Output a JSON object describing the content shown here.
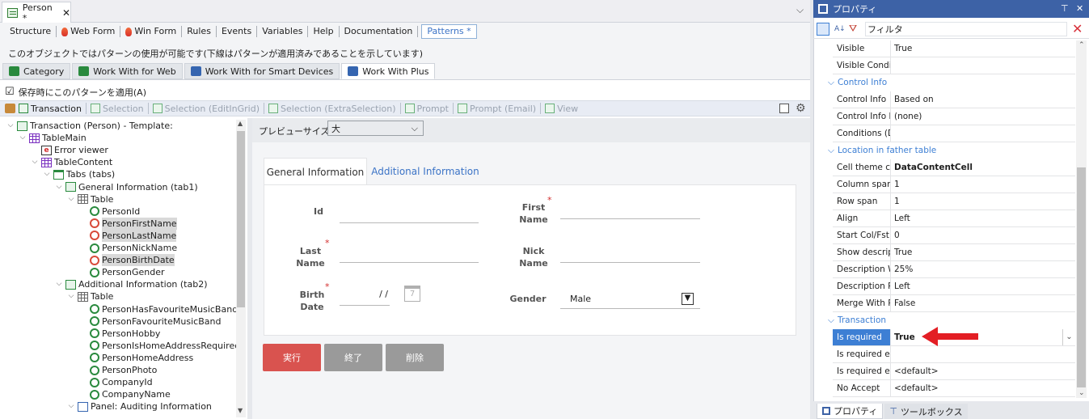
{
  "document_tab": {
    "title": "Person *",
    "close": "✕"
  },
  "collapse_glyph": "⌵",
  "view_tabs": [
    "Structure",
    "Web Form",
    "Win Form",
    "Rules",
    "Events",
    "Variables",
    "Help",
    "Documentation",
    "Patterns *"
  ],
  "message": "このオブジェクトではパターンの使用が可能です(下線はパターンが適用済みであることを示しています)",
  "pattern_tabs": [
    "Category",
    "Work With for Web",
    "Work With for Smart Devices",
    "Work With Plus"
  ],
  "apply_on_save": {
    "label": "保存時にこのパターンを適用(A)",
    "checked": "☑"
  },
  "template_tabs": [
    "Transaction",
    "Selection",
    "Selection (EditInGrid)",
    "Selection (ExtraSelection)",
    "Prompt",
    "Prompt (Email)",
    "View"
  ],
  "tree": [
    {
      "label": "Transaction (Person) - Template:",
      "icon": "trn",
      "exp": "⌵"
    },
    {
      "label": "TableMain",
      "icon": "grid",
      "exp": "⌵"
    },
    {
      "label": "Error viewer",
      "icon": "err",
      "exp": ""
    },
    {
      "label": "TableContent",
      "icon": "grid",
      "exp": "⌵"
    },
    {
      "label": "Tabs (tabs)",
      "icon": "tabs",
      "exp": "⌵"
    },
    {
      "label": "General Information (tab1)",
      "icon": "tab",
      "exp": "⌵"
    },
    {
      "label": "Table",
      "icon": "tbl",
      "exp": "⌵"
    },
    {
      "label": "PersonId",
      "icon": "att",
      "exp": ""
    },
    {
      "label": "PersonFirstName",
      "icon": "att r",
      "exp": "",
      "sel": true
    },
    {
      "label": "PersonLastName",
      "icon": "att r",
      "exp": "",
      "sel": true
    },
    {
      "label": "PersonNickName",
      "icon": "att",
      "exp": ""
    },
    {
      "label": "PersonBirthDate",
      "icon": "att r",
      "exp": "",
      "sel": true
    },
    {
      "label": "PersonGender",
      "icon": "att",
      "exp": ""
    },
    {
      "label": "Additional Information (tab2)",
      "icon": "tab",
      "exp": "⌵"
    },
    {
      "label": "Table",
      "icon": "tbl",
      "exp": "⌵"
    },
    {
      "label": "PersonHasFavouriteMusicBand",
      "icon": "att",
      "exp": ""
    },
    {
      "label": "PersonFavouriteMusicBand",
      "icon": "att",
      "exp": ""
    },
    {
      "label": "PersonHobby",
      "icon": "att",
      "exp": ""
    },
    {
      "label": "PersonIsHomeAddressRequired",
      "icon": "att",
      "exp": ""
    },
    {
      "label": "PersonHomeAddress",
      "icon": "att",
      "exp": ""
    },
    {
      "label": "PersonPhoto",
      "icon": "att",
      "exp": ""
    },
    {
      "label": "CompanyId",
      "icon": "att",
      "exp": ""
    },
    {
      "label": "CompanyName",
      "icon": "att",
      "exp": ""
    },
    {
      "label": "Panel: Auditing Information",
      "icon": "pnl",
      "exp": "⌵"
    }
  ],
  "preview": {
    "size_label": "プレビューサイズ",
    "size_value": "大",
    "tabs": [
      "General Information",
      "Additional Information"
    ],
    "fields": {
      "id": "Id",
      "first_name": "First\nName",
      "last_name": "Last\nName",
      "nick_name": "Nick\nName",
      "birth_date": "Birth\nDate",
      "gender": "Gender"
    },
    "date_placeholder": "/ /",
    "calendar": "7",
    "gender_value": "Male",
    "required_mark": "*",
    "buttons": {
      "run": "実行",
      "close": "終了",
      "delete": "削除"
    }
  },
  "properties": {
    "title": "プロパティ",
    "pin": "⊤",
    "close": "✕",
    "filter": "フィルタ",
    "sections": [
      {
        "rows": [
          {
            "name": "Visible",
            "value": "True"
          },
          {
            "name": "Visible Conditi",
            "value": ""
          }
        ]
      },
      {
        "category": "Control Info",
        "rows": [
          {
            "name": "Control Info",
            "value": "Based on"
          },
          {
            "name": "Control Info ba",
            "value": "(none)"
          },
          {
            "name": "Conditions (Dy",
            "value": ""
          }
        ]
      },
      {
        "category": "Location in father table",
        "rows": [
          {
            "name": "Cell theme clas",
            "value": "DataContentCell",
            "bold": true
          },
          {
            "name": "Column span",
            "value": "1"
          },
          {
            "name": "Row span",
            "value": "1"
          },
          {
            "name": "Align",
            "value": "Left"
          },
          {
            "name": "Start Col/Fst A",
            "value": "0"
          },
          {
            "name": "Show descripti",
            "value": "True"
          },
          {
            "name": "Description Wi",
            "value": "25%"
          },
          {
            "name": "Description Po",
            "value": "Left"
          },
          {
            "name": "Merge With Pr",
            "value": "False"
          }
        ]
      },
      {
        "category": "Transaction",
        "rows": [
          {
            "name": "Is required",
            "value": "True",
            "bold": true,
            "sel": true
          },
          {
            "name": "Is required ext",
            "value": ""
          },
          {
            "name": "Is required erro",
            "value": "<default>"
          },
          {
            "name": "No Accept",
            "value": "<default>"
          }
        ]
      }
    ],
    "bottom_tabs": [
      "プロパティ",
      "ツールボックス"
    ]
  },
  "colors": {
    "accent": "#3d62a6",
    "danger": "#d9534f",
    "arrow": "#e31e24"
  }
}
